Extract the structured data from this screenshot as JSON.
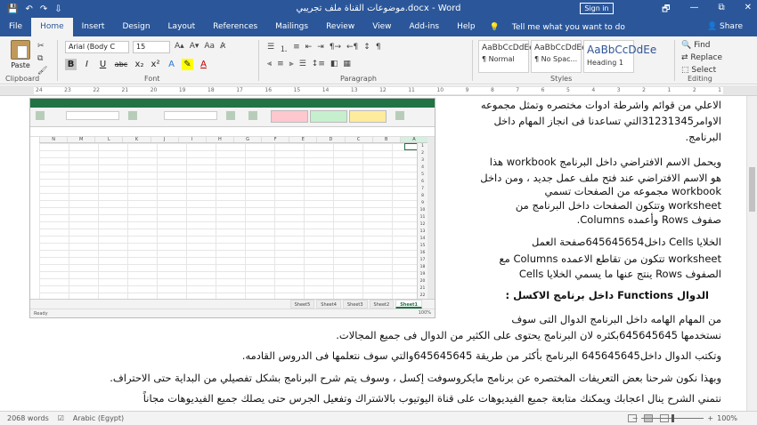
{
  "window": {
    "title": "موضوعات القناة ملف تجريبي.docx - Word",
    "signin": "Sign in",
    "qat": [
      "💾",
      "↶",
      "↷",
      "⇩"
    ],
    "controls": [
      "🗗",
      "—",
      "⧉",
      "✕"
    ]
  },
  "tabs": [
    "File",
    "Home",
    "Insert",
    "Design",
    "Layout",
    "References",
    "Mailings",
    "Review",
    "View",
    "Add-ins",
    "Help"
  ],
  "active_tab": "Home",
  "tell_me": "Tell me what you want to do",
  "share": "Share",
  "ribbon": {
    "paste": "Paste",
    "font_name": "Arial (Body C",
    "font_size": "15",
    "groups": [
      "Clipboard",
      "Font",
      "Paragraph",
      "Styles",
      "Editing"
    ],
    "format_buttons": [
      "B",
      "I",
      "U",
      "abc",
      "x₂",
      "x²",
      "A",
      "A"
    ],
    "styles": [
      {
        "sample": "AaBbCcDdEe",
        "name": "¶ Normal"
      },
      {
        "sample": "AaBbCcDdEe",
        "name": "¶ No Spac..."
      },
      {
        "sample": "AaBbCcDdEe",
        "name": "Heading 1"
      }
    ],
    "editing": [
      "Find",
      "Replace",
      "Select"
    ]
  },
  "ruler": [
    "24",
    "23",
    "22",
    "21",
    "20",
    "19",
    "18",
    "17",
    "16",
    "15",
    "14",
    "13",
    "12",
    "11",
    "10",
    "9",
    "8",
    "7",
    "6",
    "5",
    "4",
    "3",
    "2",
    "1",
    "2",
    "1"
  ],
  "excel": {
    "columns": [
      "N",
      "M",
      "L",
      "K",
      "J",
      "I",
      "H",
      "G",
      "F",
      "E",
      "D",
      "C",
      "B",
      "A"
    ],
    "rows": [
      "1",
      "2",
      "3",
      "4",
      "5",
      "6",
      "7",
      "8",
      "9",
      "10",
      "11",
      "12",
      "13",
      "14",
      "15",
      "16",
      "17",
      "18",
      "19",
      "20",
      "21",
      "22"
    ],
    "sheets": [
      "Sheet5",
      "Sheet4",
      "Sheet3",
      "Sheet2",
      "Sheet1"
    ],
    "active_sheet": "Sheet1",
    "status": "Ready",
    "zoom": "100%"
  },
  "document": {
    "p1": "الاعلي من قوائم واشرطة ادوات مختصره وتمثل مجموعه",
    "p2": "الاوامر31231345التي تساعدنا فى انجاز المهام داخل",
    "p3": "البرنامج.",
    "p4": "ويحمل الاسم الافتراضي داخل البرنامج workbook هذا",
    "p5": "هو الاسم الافتراضي عند فتح ملف عمل جديد ، ومن داخل",
    "p6": "workbook مجموعه من الصفحات تسمي",
    "p7": "worksheet وتتكون الصفحات داخل البرنامج من",
    "p8": "صفوف Rows وأعمده Columns.",
    "p9": "الخلايا Cells داخل645645654صفحة العمل",
    "p10": "worksheet تتكون من تقاطع الاعمده Columns مع",
    "p11": "الصفوف Rows ينتج عنها ما يسمي الخلايا Cells",
    "p12": "الدوال Functions داخل برنامج الاكسل :",
    "p13": "من المهام الهامه داخل البرنامج الدوال التى سوف",
    "p14": "نستخدمها 645645645بكثره لان البرنامج يحتوى على الكثير من الدوال فى جميع المجالات.",
    "p15": "وتكتب الدوال داخل645645645 البرنامج بأكثر من طريقة 645645645والتي سوف نتعلمها فى الدروس القادمه.",
    "p16": "وبهذا نكون شرحنا بعض التعريفات المختصره عن برنامج مايكروسوفت إكسل ، وسوف يتم شرح البرنامج بشكل تفصيلي من البداية حتى الاحتراف.",
    "p17": "نتمني الشرح ينال اعجابك ويمكنك متابعة جميع الفيديوهات على قناة اليوتيوب بالاشتراك وتفعيل الجرس حتى يصلك جميع الفيديوهات مجاناً"
  },
  "status": {
    "words": "2068 words",
    "language": "Arabic (Egypt)",
    "zoom": "100%"
  }
}
